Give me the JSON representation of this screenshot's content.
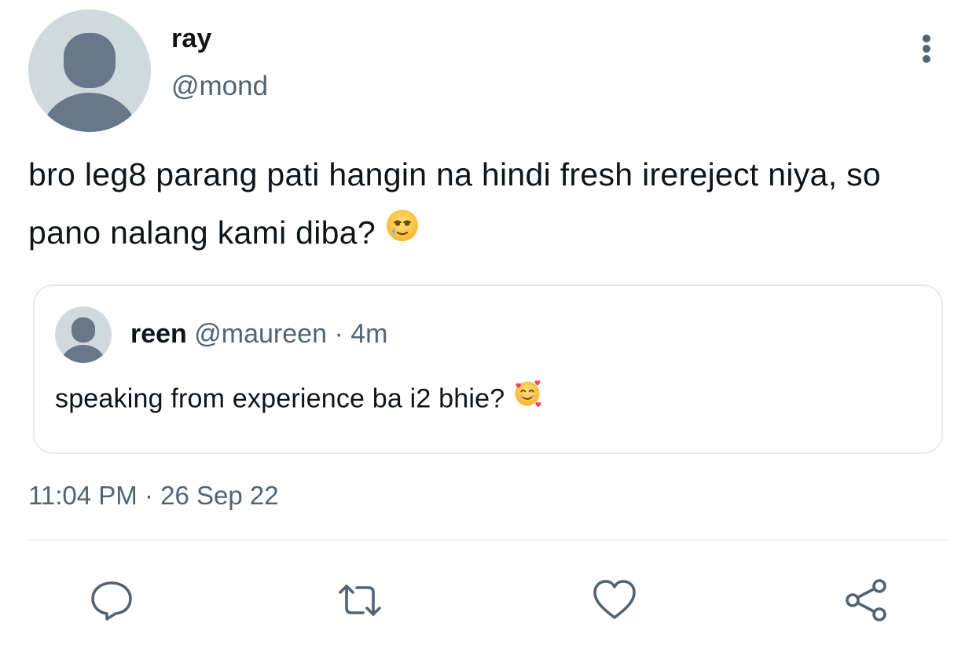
{
  "tweet": {
    "author": {
      "display_name": "ray",
      "handle": "@mond"
    },
    "text": "bro leg8 parang pati hangin na hindi fresh irereject niya, so pano nalang kami diba?",
    "text_emoji": "face-holding-back-tears-icon",
    "timestamp": "11:04 PM · 26 Sep 22"
  },
  "quote": {
    "display_name": "reen",
    "handle": "@maureen",
    "meta_separator": "·",
    "age": "4m",
    "text": "speaking from experience ba i2 bhie?",
    "text_emoji": "smiling-face-with-hearts-icon"
  },
  "actions": [
    {
      "name": "reply",
      "icon": "reply-icon"
    },
    {
      "name": "retweet",
      "icon": "retweet-icon"
    },
    {
      "name": "like",
      "icon": "heart-icon"
    },
    {
      "name": "share",
      "icon": "share-icon"
    }
  ],
  "colors": {
    "text_primary": "#0f1419",
    "text_secondary": "#536471",
    "avatar_bg": "#cfd9de",
    "avatar_fg": "#687789",
    "border": "#e4e9ed"
  }
}
